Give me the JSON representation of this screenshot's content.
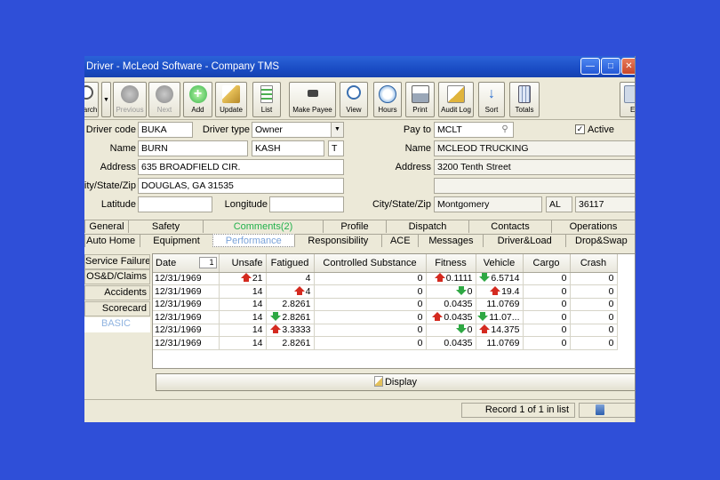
{
  "window": {
    "title": "Driver - McLeod Software - Company TMS",
    "min_label": "—",
    "max_label": "□",
    "close_label": "✕"
  },
  "toolbar": {
    "search": "Search",
    "previous": "Previous",
    "next": "Next",
    "add": "Add",
    "update": "Update",
    "list": "List",
    "make_payee": "Make Payee",
    "view": "View",
    "hours": "Hours",
    "print": "Print",
    "audit_log": "Audit Log",
    "sort": "Sort",
    "totals": "Totals",
    "extra": "E"
  },
  "form": {
    "driver_code_label": "Driver code",
    "driver_code": "BUKA",
    "driver_type_label": "Driver type",
    "driver_type": "Owner",
    "name_label": "Name",
    "first_name": "BURN",
    "last_name": "KASH",
    "middle_initial": "T",
    "address_label": "Address",
    "address": "635 BROADFIELD CIR.",
    "city_label": "City/State/Zip",
    "city": "DOUGLAS, GA 31535",
    "latitude_label": "Latitude",
    "longitude_label": "Longitude",
    "pay_to_label": "Pay to",
    "pay_to": "MCLT",
    "active_label": "Active",
    "active_checked": "✓",
    "pay_name_label": "Name",
    "pay_name": "MCLEOD TRUCKING",
    "pay_address_label": "Address",
    "pay_address": "3200 Tenth Street",
    "pay_city_label": "City/State/Zip",
    "pay_city": "Montgomery",
    "pay_state": "AL",
    "pay_zip": "36117"
  },
  "tabs_row1": [
    "General",
    "Safety",
    "Comments(2)",
    "Profile",
    "Dispatch",
    "Contacts",
    "Operations"
  ],
  "tabs_row2": [
    "Auto Home",
    "Equipment",
    "Performance",
    "Responsibility",
    "ACE",
    "Messages",
    "Driver&Load",
    "Drop&Swap"
  ],
  "side_menu": [
    "Service Failures",
    "OS&D/Claims",
    "Accidents",
    "Scorecard",
    "BASIC"
  ],
  "grid": {
    "headers": [
      "Date",
      "Unsafe",
      "Fatigued",
      "Controlled Substance",
      "Fitness",
      "Vehicle",
      "Cargo",
      "Crash"
    ],
    "sort_indicator": "1",
    "rows": [
      [
        "12/31/1969",
        "21",
        "4",
        "0",
        "0.1111",
        "6.5714",
        "0",
        "0"
      ],
      [
        "12/31/1969",
        "14",
        "4",
        "0",
        "0",
        "19.4",
        "0",
        "0"
      ],
      [
        "12/31/1969",
        "14",
        "2.8261",
        "0",
        "0.0435",
        "11.0769",
        "0",
        "0"
      ],
      [
        "12/31/1969",
        "14",
        "2.8261",
        "0",
        "0.0435",
        "11.07...",
        "0",
        "0"
      ],
      [
        "12/31/1969",
        "14",
        "3.3333",
        "0",
        "0",
        "14.375",
        "0",
        "0"
      ],
      [
        "12/31/1969",
        "14",
        "2.8261",
        "0",
        "0.0435",
        "11.0769",
        "0",
        "0"
      ]
    ],
    "arrows": [
      [
        "",
        "up",
        "",
        "",
        "up",
        "down",
        "",
        ""
      ],
      [
        "",
        "",
        "up",
        "",
        "down",
        "up",
        "",
        ""
      ],
      [
        "",
        "",
        "",
        "",
        "",
        "",
        "",
        ""
      ],
      [
        "",
        "",
        "down",
        "",
        "up",
        "down",
        "",
        ""
      ],
      [
        "",
        "",
        "up",
        "",
        "down",
        "up",
        "",
        ""
      ],
      [
        "",
        "",
        "",
        "",
        "",
        "",
        "",
        ""
      ]
    ]
  },
  "display_button": "Display",
  "status": {
    "record": "Record 1 of 1 in list"
  },
  "colors": {
    "desktop": "#2f4fd8",
    "titlebar": "#1a4cc4",
    "up_arrow": "#d42a1f",
    "down_arrow": "#2ea843",
    "tab_green": "#22b14c"
  }
}
